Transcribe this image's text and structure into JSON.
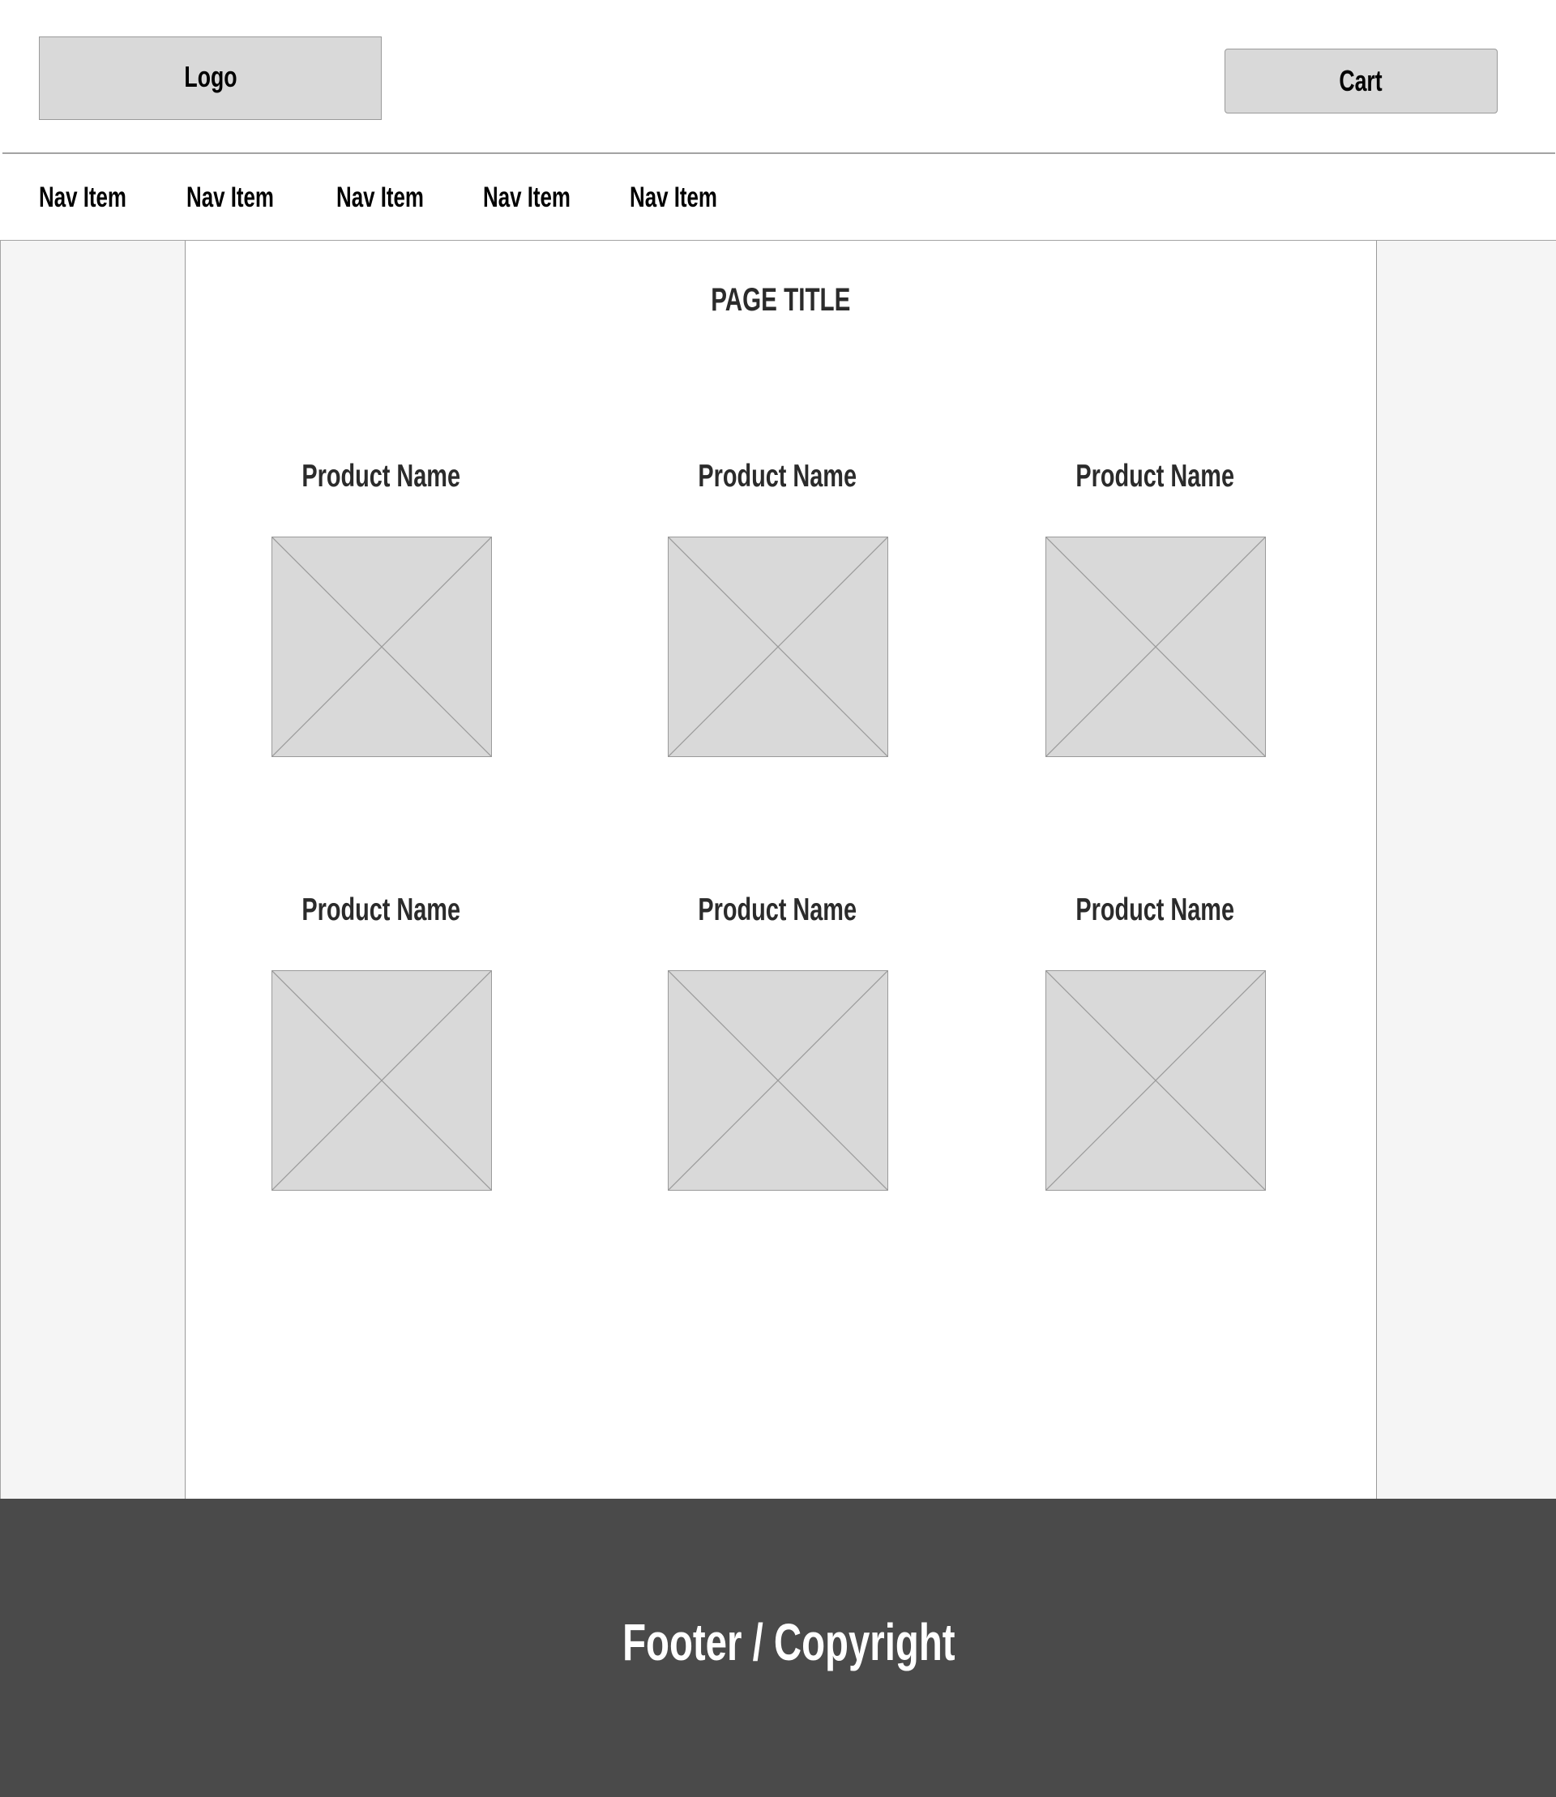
{
  "header": {
    "logo_label": "Logo",
    "cart_label": "Cart"
  },
  "nav": {
    "items": [
      {
        "label": "Nav Item"
      },
      {
        "label": "Nav Item"
      },
      {
        "label": "Nav Item"
      },
      {
        "label": "Nav Item"
      },
      {
        "label": "Nav Item"
      }
    ]
  },
  "main": {
    "page_title": "PAGE TITLE",
    "products": [
      {
        "name": "Product Name",
        "image": "image-placeholder-icon"
      },
      {
        "name": "Product Name",
        "image": "image-placeholder-icon"
      },
      {
        "name": "Product Name",
        "image": "image-placeholder-icon"
      },
      {
        "name": "Product Name",
        "image": "image-placeholder-icon"
      },
      {
        "name": "Product Name",
        "image": "image-placeholder-icon"
      },
      {
        "name": "Product Name",
        "image": "image-placeholder-icon"
      }
    ]
  },
  "footer": {
    "text": "Footer / Copyright"
  },
  "colors": {
    "placeholder_fill": "#d9d9d9",
    "sidebar_bg": "#f5f5f5",
    "footer_bg": "#4a4a4a",
    "border": "#9a9a9a",
    "heading_text": "#2b2b2b"
  }
}
